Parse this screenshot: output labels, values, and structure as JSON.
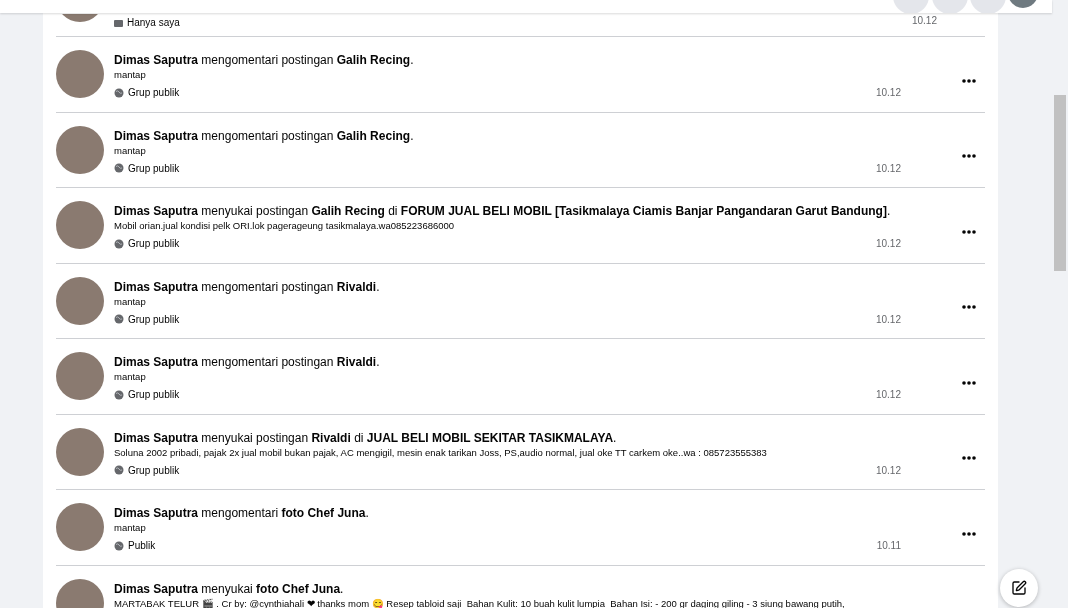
{
  "activity": [
    {
      "kind": "tail",
      "privacy": "Hanya saya",
      "private": true,
      "time": "10.12"
    },
    {
      "kind": "full",
      "headline": "**Dimas Saputra** mengomentari postingan **Galih Recing**.",
      "snippet": "mantap",
      "privacy": "Grup publik",
      "private": false,
      "time": "10.12"
    },
    {
      "kind": "full",
      "headline": "**Dimas Saputra** mengomentari postingan **Galih Recing**.",
      "snippet": "mantap",
      "privacy": "Grup publik",
      "private": false,
      "time": "10.12"
    },
    {
      "kind": "full",
      "headline": "**Dimas Saputra** menyukai postingan **Galih Recing** di **FORUM JUAL BELI MOBIL [Tasikmalaya Ciamis Banjar Pangandaran Garut Bandung]**.",
      "snippet": "Mobil orian.jual kondisi pelk ORI.lok pagerageung tasikmalaya.wa085223686000",
      "privacy": "Grup publik",
      "private": false,
      "time": "10.12"
    },
    {
      "kind": "full",
      "headline": "**Dimas Saputra** mengomentari postingan **Rivaldi**.",
      "snippet": "mantap",
      "privacy": "Grup publik",
      "private": false,
      "time": "10.12"
    },
    {
      "kind": "full",
      "headline": "**Dimas Saputra** mengomentari postingan **Rivaldi**.",
      "snippet": "mantap",
      "privacy": "Grup publik",
      "private": false,
      "time": "10.12"
    },
    {
      "kind": "full",
      "headline": "**Dimas Saputra** menyukai postingan **Rivaldi** di **JUAL BELI MOBIL SEKITAR TASIKMALAYA**.",
      "snippet": "Soluna 2002 pribadi, pajak 2x jual mobil bukan pajak, AC mengigil, mesin enak tarikan Joss, PS,audio normal, jual oke TT carkem oke..wa : 085723555383",
      "privacy": "Grup publik",
      "private": false,
      "time": "10.12"
    },
    {
      "kind": "full",
      "headline": "**Dimas Saputra** mengomentari **foto Chef Juna**.",
      "snippet": "mantap",
      "privacy": "Publik",
      "private": false,
      "time": "10.11"
    },
    {
      "kind": "head",
      "headline": "**Dimas Saputra** menyukai **foto Chef Juna**.",
      "snippet": "MARTABAK TELUR 🎬 . Cr by: @cynthiahali ❤ thanks mom 😋 Resep tabloid saji  Bahan Kulit: 10 buah kulit lumpia  Bahan Isi: - 200 gr daging giling - 3 siung bawang putih,"
    }
  ]
}
